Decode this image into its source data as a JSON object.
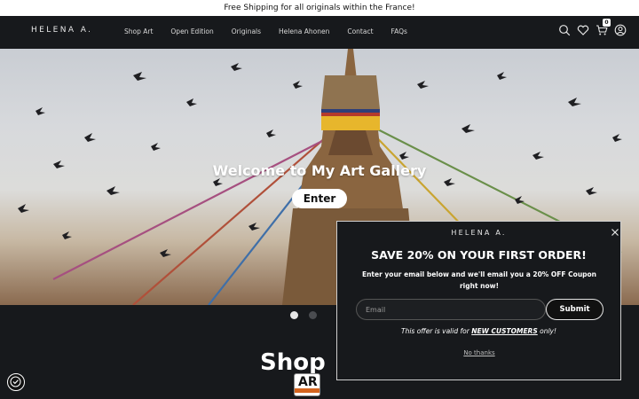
{
  "announcement": "Free Shipping for all originals within the France!",
  "header": {
    "logo": "HELENA A.",
    "nav": [
      "Shop Art",
      "Open Edition",
      "Originals",
      "Helena Ahonen",
      "Contact",
      "FAQs"
    ],
    "cart_count": "0",
    "icons": [
      "search-icon",
      "heart-icon",
      "cart-icon",
      "account-icon"
    ]
  },
  "hero": {
    "title": "Welcome to My Art Gallery",
    "button": "Enter",
    "slides": 2,
    "active_slide": 1
  },
  "section": {
    "heading": "Shop",
    "badge": "AR"
  },
  "popup": {
    "brand": "HELENA A.",
    "title": "SAVE 20% ON YOUR FIRST ORDER!",
    "subtitle": "Enter your email below and we'll email you a 20% OFF Coupon right now!",
    "email_placeholder": "Email",
    "submit": "Submit",
    "offer_prefix": "This offer is valid for ",
    "offer_highlight": "NEW CUSTOMERS",
    "offer_suffix": " only!",
    "no_thanks": "No thanks"
  },
  "colors": {
    "background": "#17191c",
    "text": "#ffffff",
    "banner": "#ffffff"
  }
}
